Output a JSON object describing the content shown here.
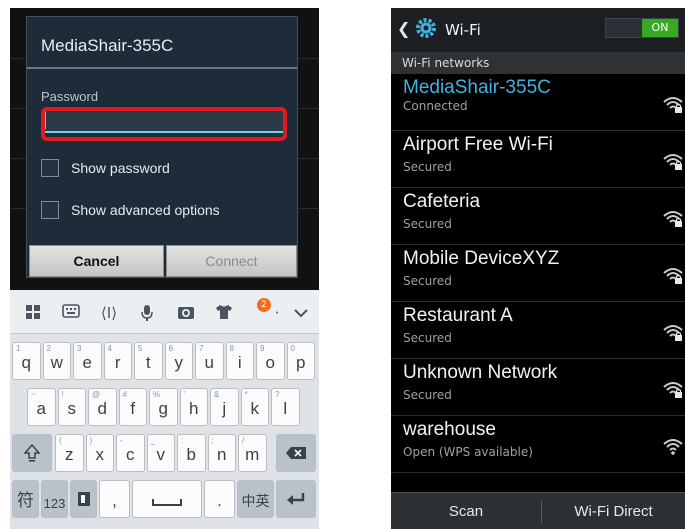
{
  "dialog": {
    "title": "MediaShair-355C",
    "password_label": "Password",
    "password_value": "",
    "show_password": "Show password",
    "show_advanced": "Show advanced options",
    "cancel": "Cancel",
    "connect": "Connect"
  },
  "keyboard": {
    "badge": "2",
    "row1": [
      {
        "ch": "q",
        "hint": "1"
      },
      {
        "ch": "w",
        "hint": "2"
      },
      {
        "ch": "e",
        "hint": "3"
      },
      {
        "ch": "r",
        "hint": "4"
      },
      {
        "ch": "t",
        "hint": "5"
      },
      {
        "ch": "y",
        "hint": "6"
      },
      {
        "ch": "u",
        "hint": "7"
      },
      {
        "ch": "i",
        "hint": "8"
      },
      {
        "ch": "o",
        "hint": "9"
      },
      {
        "ch": "p",
        "hint": "0"
      }
    ],
    "row2": [
      {
        "ch": "a",
        "hint": "~"
      },
      {
        "ch": "s",
        "hint": "!"
      },
      {
        "ch": "d",
        "hint": "@"
      },
      {
        "ch": "f",
        "hint": "#"
      },
      {
        "ch": "g",
        "hint": "%"
      },
      {
        "ch": "h",
        "hint": "'"
      },
      {
        "ch": "j",
        "hint": "&"
      },
      {
        "ch": "k",
        "hint": "*"
      },
      {
        "ch": "l",
        "hint": "?"
      }
    ],
    "row3": [
      {
        "ch": "z",
        "hint": "("
      },
      {
        "ch": "x",
        "hint": ")"
      },
      {
        "ch": "c",
        "hint": "-"
      },
      {
        "ch": "v",
        "hint": "_"
      },
      {
        "ch": "b",
        "hint": ":"
      },
      {
        "ch": "n",
        "hint": ";"
      },
      {
        "ch": "m",
        "hint": "/"
      }
    ],
    "row4": {
      "symbols": "符",
      "numbers": "123",
      "comma": ",",
      "period": ".",
      "lang": "中英"
    }
  },
  "wifi": {
    "title": "Wi-Fi",
    "toggle": "ON",
    "section": "Wi-Fi networks",
    "networks": [
      {
        "name": "MediaShair-355C",
        "status": "Connected"
      },
      {
        "name": "Airport Free Wi-Fi",
        "status": "Secured"
      },
      {
        "name": "Cafeteria",
        "status": "Secured"
      },
      {
        "name": "Mobile DeviceXYZ",
        "status": "Secured"
      },
      {
        "name": "Restaurant A",
        "status": "Secured"
      },
      {
        "name": "Unknown Network",
        "status": "Secured"
      },
      {
        "name": "warehouse",
        "status": "Open (WPS available)"
      }
    ],
    "scan": "Scan",
    "direct": "Wi-Fi Direct"
  },
  "colors": {
    "connected": "#3fb2e0",
    "highlight": "#e11a22",
    "toggle_on": "#39a822"
  }
}
